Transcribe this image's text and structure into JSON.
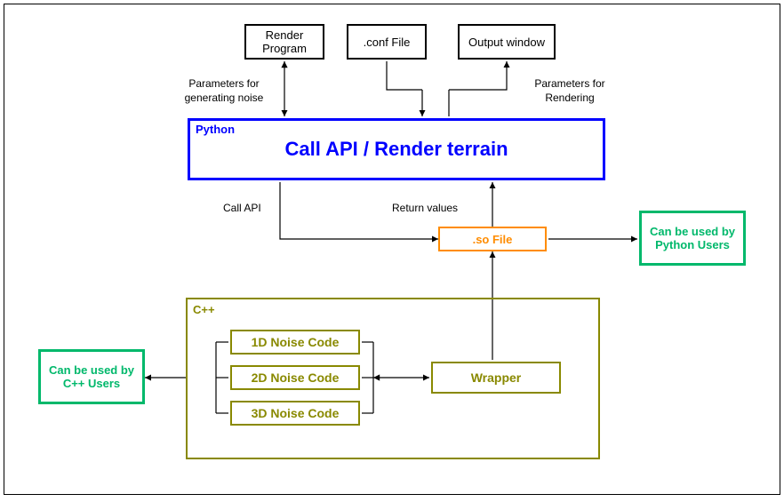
{
  "top_boxes": {
    "render_program": "Render\nProgram",
    "conf_file": ".conf File",
    "output_window": "Output window"
  },
  "python_box": {
    "language_label": "Python",
    "main_label": "Call API / Render terrain"
  },
  "so_file": ".so File",
  "green_boxes": {
    "python_users": "Can be used by Python Users",
    "cpp_users": "Can be used by C++ Users"
  },
  "cpp_box": {
    "language_label": "C++",
    "wrapper": "Wrapper",
    "noise1d": "1D Noise Code",
    "noise2d": "2D Noise Code",
    "noise3d": "3D Noise Code"
  },
  "edge_labels": {
    "params_noise": "Parameters for\ngenerating noise",
    "params_render": "Parameters for\nRendering",
    "call_api": "Call API",
    "return_values": "Return values"
  },
  "chart_data": {
    "type": "diagram",
    "title": "System architecture: Python/C++ noise generation and rendering pipeline",
    "nodes": [
      {
        "id": "render_program",
        "label": "Render Program",
        "group": "top"
      },
      {
        "id": "conf_file",
        "label": ".conf File",
        "group": "top"
      },
      {
        "id": "output_window",
        "label": "Output window",
        "group": "top"
      },
      {
        "id": "python",
        "label": "Call API / Render terrain",
        "language": "Python"
      },
      {
        "id": "so_file",
        "label": ".so File"
      },
      {
        "id": "python_users",
        "label": "Can be used by Python Users"
      },
      {
        "id": "cpp_users",
        "label": "Can be used by C++ Users"
      },
      {
        "id": "cpp",
        "label": "C++",
        "children": [
          "noise1d",
          "noise2d",
          "noise3d",
          "wrapper"
        ]
      },
      {
        "id": "noise1d",
        "label": "1D Noise Code",
        "parent": "cpp"
      },
      {
        "id": "noise2d",
        "label": "2D Noise Code",
        "parent": "cpp"
      },
      {
        "id": "noise3d",
        "label": "3D Noise Code",
        "parent": "cpp"
      },
      {
        "id": "wrapper",
        "label": "Wrapper",
        "parent": "cpp"
      }
    ],
    "edges": [
      {
        "from": "render_program",
        "to": "python",
        "label": "Parameters for generating noise",
        "direction": "both"
      },
      {
        "from": "conf_file",
        "to": "python",
        "direction": "to"
      },
      {
        "from": "python",
        "to": "output_window",
        "label": "Parameters for Rendering",
        "direction": "to"
      },
      {
        "from": "python",
        "to": "so_file",
        "label": "Call API",
        "direction": "to"
      },
      {
        "from": "so_file",
        "to": "python",
        "label": "Return values",
        "direction": "to"
      },
      {
        "from": "so_file",
        "to": "python_users",
        "direction": "to"
      },
      {
        "from": "wrapper",
        "to": "so_file",
        "direction": "to"
      },
      {
        "from": "noise1d",
        "to": "wrapper",
        "direction": "both_via_bracket"
      },
      {
        "from": "noise2d",
        "to": "wrapper",
        "direction": "both_via_bracket"
      },
      {
        "from": "noise3d",
        "to": "wrapper",
        "direction": "both_via_bracket"
      },
      {
        "from": "cpp",
        "to": "cpp_users",
        "direction": "to"
      }
    ]
  }
}
